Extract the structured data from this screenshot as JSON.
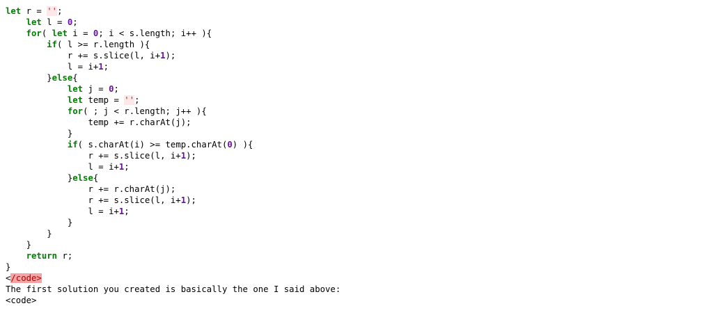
{
  "lines": [
    [
      [
        "kw",
        "let"
      ],
      [
        "plain",
        " r = "
      ],
      [
        "str",
        "''"
      ],
      [
        "plain",
        ";"
      ]
    ],
    [
      [
        "plain",
        "    "
      ],
      [
        "kw",
        "let"
      ],
      [
        "plain",
        " l = "
      ],
      [
        "num",
        "0"
      ],
      [
        "plain",
        ";"
      ]
    ],
    [
      [
        "plain",
        "    "
      ],
      [
        "kw",
        "for"
      ],
      [
        "plain",
        "( "
      ],
      [
        "kw",
        "let"
      ],
      [
        "plain",
        " i = "
      ],
      [
        "num",
        "0"
      ],
      [
        "plain",
        "; i < s.length; i++ ){"
      ]
    ],
    [
      [
        "plain",
        "        "
      ],
      [
        "kw",
        "if"
      ],
      [
        "plain",
        "( l >= r.length ){"
      ]
    ],
    [
      [
        "plain",
        "            r += s.slice(l, i+"
      ],
      [
        "num",
        "1"
      ],
      [
        "plain",
        ");"
      ]
    ],
    [
      [
        "plain",
        "            l = i+"
      ],
      [
        "num",
        "1"
      ],
      [
        "plain",
        ";"
      ]
    ],
    [
      [
        "plain",
        "        }"
      ],
      [
        "kw",
        "else"
      ],
      [
        "plain",
        "{"
      ]
    ],
    [
      [
        "plain",
        "            "
      ],
      [
        "kw",
        "let"
      ],
      [
        "plain",
        " j = "
      ],
      [
        "num",
        "0"
      ],
      [
        "plain",
        ";"
      ]
    ],
    [
      [
        "plain",
        "            "
      ],
      [
        "kw",
        "let"
      ],
      [
        "plain",
        " temp = "
      ],
      [
        "str",
        "''"
      ],
      [
        "plain",
        ";"
      ]
    ],
    [
      [
        "plain",
        "            "
      ],
      [
        "kw",
        "for"
      ],
      [
        "plain",
        "( ; j < r.length; j++ ){"
      ]
    ],
    [
      [
        "plain",
        "                temp += r.charAt(j);"
      ]
    ],
    [
      [
        "plain",
        "            }"
      ]
    ],
    [
      [
        "plain",
        "            "
      ],
      [
        "kw",
        "if"
      ],
      [
        "plain",
        "( s.charAt(i) >= temp.charAt("
      ],
      [
        "num",
        "0"
      ],
      [
        "plain",
        ") ){"
      ]
    ],
    [
      [
        "plain",
        "                r += s.slice(l, i+"
      ],
      [
        "num",
        "1"
      ],
      [
        "plain",
        ");"
      ]
    ],
    [
      [
        "plain",
        "                l = i+"
      ],
      [
        "num",
        "1"
      ],
      [
        "plain",
        ";"
      ]
    ],
    [
      [
        "plain",
        "            }"
      ],
      [
        "kw",
        "else"
      ],
      [
        "plain",
        "{"
      ]
    ],
    [
      [
        "plain",
        "                r += r.charAt(j);"
      ]
    ],
    [
      [
        "plain",
        "                r += s.slice(l, i+"
      ],
      [
        "num",
        "1"
      ],
      [
        "plain",
        ");"
      ]
    ],
    [
      [
        "plain",
        "                l = i+"
      ],
      [
        "num",
        "1"
      ],
      [
        "plain",
        ";"
      ]
    ],
    [
      [
        "plain",
        "            }"
      ]
    ],
    [
      [
        "plain",
        "        }"
      ]
    ],
    [
      [
        "plain",
        "    }"
      ]
    ],
    [
      [
        "plain",
        "    "
      ],
      [
        "kw",
        "return"
      ],
      [
        "plain",
        " r;"
      ]
    ],
    [
      [
        "plain",
        "}"
      ]
    ],
    [
      [
        "plain",
        "<"
      ],
      [
        "err",
        "/code>"
      ]
    ],
    [
      [
        "plain",
        "The first solution you created is basically the one I said above:"
      ]
    ],
    [
      [
        "plain",
        "<code>"
      ]
    ]
  ],
  "colors": {
    "keyword": "#008000",
    "number": "#6a0dad",
    "string": "#ba2121",
    "string_bg": "#fce8e8",
    "error": "#b00000",
    "error_bg": "#f4a4a4"
  }
}
